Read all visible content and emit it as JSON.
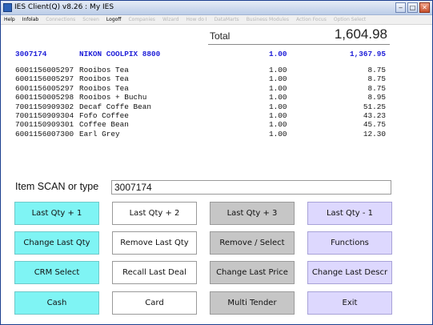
{
  "window": {
    "title": "IES Client(Q) v8.26 : My IES",
    "buttons": {
      "minimize": "‒",
      "maximize": "□",
      "close": "✕"
    }
  },
  "menu": [
    {
      "label": "Help",
      "enabled": true
    },
    {
      "label": "Infolab",
      "enabled": true
    },
    {
      "label": "Connections",
      "enabled": false
    },
    {
      "label": "Screen",
      "enabled": false
    },
    {
      "label": "Logoff",
      "enabled": true
    },
    {
      "label": "Companies",
      "enabled": false
    },
    {
      "label": "Wizard",
      "enabled": false
    },
    {
      "label": "How do I",
      "enabled": false
    },
    {
      "label": "DataMarts",
      "enabled": false
    },
    {
      "label": "Business Modules",
      "enabled": false
    },
    {
      "label": "Action Focus",
      "enabled": false
    },
    {
      "label": "Option Select",
      "enabled": false
    }
  ],
  "total": {
    "label": "Total",
    "value": "1,604.98"
  },
  "lines": [
    {
      "code": "3007174",
      "desc": "NIKON COOLPIX 8800",
      "qty": "1.00",
      "amount": "1,367.95",
      "highlight": true
    },
    {
      "code": "6001156005297",
      "desc": "Rooibos Tea",
      "qty": "1.00",
      "amount": "8.75",
      "highlight": false
    },
    {
      "code": "6001156005297",
      "desc": "Rooibos Tea",
      "qty": "1.00",
      "amount": "8.75",
      "highlight": false
    },
    {
      "code": "6001156005297",
      "desc": "Rooibos Tea",
      "qty": "1.00",
      "amount": "8.75",
      "highlight": false
    },
    {
      "code": "6001150005298",
      "desc": "Rooibos + Buchu",
      "qty": "1.00",
      "amount": "8.95",
      "highlight": false
    },
    {
      "code": "7001150909302",
      "desc": "Decaf Coffe Bean",
      "qty": "1.00",
      "amount": "51.25",
      "highlight": false
    },
    {
      "code": "7001150909304",
      "desc": "Fofo Coffee",
      "qty": "1.00",
      "amount": "43.23",
      "highlight": false
    },
    {
      "code": "7001150909301",
      "desc": "Coffee Bean",
      "qty": "1.00",
      "amount": "45.75",
      "highlight": false
    },
    {
      "code": "6001156007300",
      "desc": "Earl Grey",
      "qty": "1.00",
      "amount": "12.30",
      "highlight": false
    }
  ],
  "scan": {
    "label": "Item SCAN or type",
    "value": "3007174"
  },
  "buttons": {
    "last_qty_plus_1": "Last Qty + 1",
    "last_qty_plus_2": "Last Qty + 2",
    "last_qty_plus_3": "Last Qty + 3",
    "last_qty_minus_1": "Last Qty - 1",
    "change_last_qty": "Change Last Qty",
    "remove_last_qty": "Remove Last Qty",
    "remove_select": "Remove / Select",
    "functions": "Functions",
    "crm_select": "CRM Select",
    "recall_last_deal": "Recall Last Deal",
    "change_last_price": "Change Last Price",
    "change_last_descr": "Change Last Descr",
    "cash": "Cash",
    "card": "Card",
    "multi_tender": "Multi Tender",
    "exit": "Exit"
  },
  "colors": {
    "highlight_line": "#2020d8",
    "button_cyan": "#7ff4f4",
    "button_gray": "#c6c6c6",
    "button_lavender": "#ddd8fe",
    "button_white": "#ffffff"
  }
}
